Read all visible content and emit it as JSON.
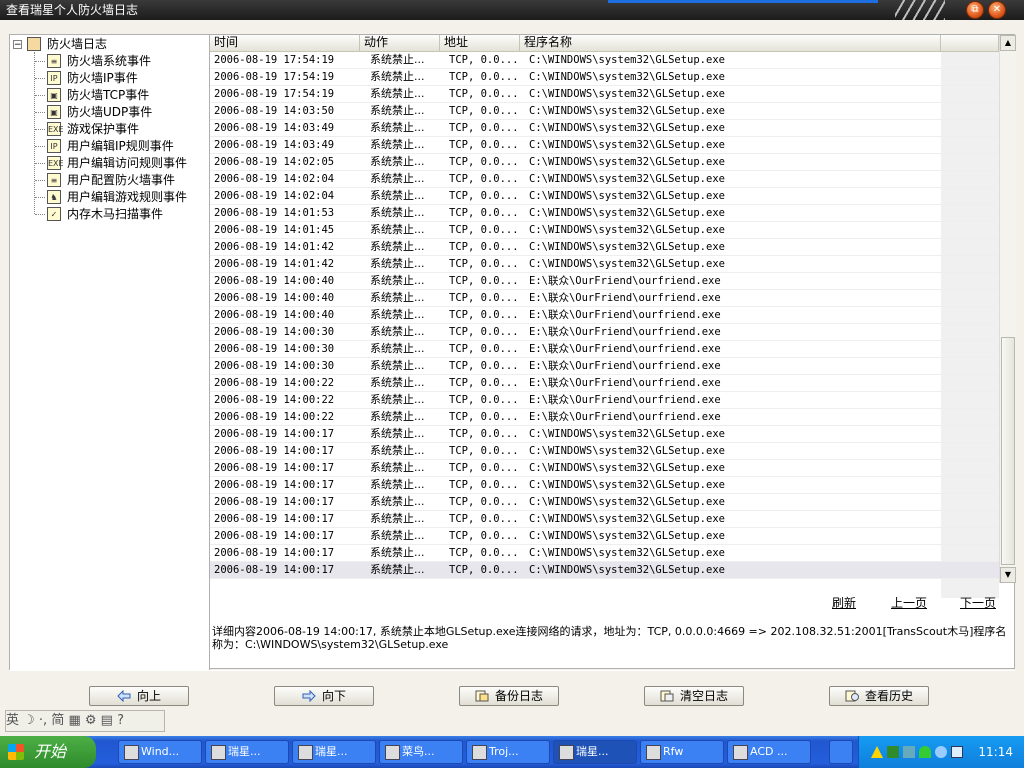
{
  "window": {
    "title": "查看瑞星个人防火墙日志",
    "restore_glyph": "⧉",
    "close_glyph": "✕"
  },
  "tree": {
    "root": {
      "label": "防火墙日志",
      "expander": "−"
    },
    "items": [
      {
        "label": "防火墙系统事件",
        "icon": "system-event-icon",
        "glyph": "≡"
      },
      {
        "label": "防火墙IP事件",
        "icon": "ip-event-icon",
        "glyph": "IP"
      },
      {
        "label": "防火墙TCP事件",
        "icon": "tcp-event-icon",
        "glyph": "▣"
      },
      {
        "label": "防火墙UDP事件",
        "icon": "udp-event-icon",
        "glyph": "▣"
      },
      {
        "label": "游戏保护事件",
        "icon": "game-protect-icon",
        "glyph": "EXE"
      },
      {
        "label": "用户编辑IP规则事件",
        "icon": "edit-ip-rule-icon",
        "glyph": "IP"
      },
      {
        "label": "用户编辑访问规则事件",
        "icon": "edit-access-rule-icon",
        "glyph": "EXE"
      },
      {
        "label": "用户配置防火墙事件",
        "icon": "config-firewall-icon",
        "glyph": "≡"
      },
      {
        "label": "用户编辑游戏规则事件",
        "icon": "edit-game-rule-icon",
        "glyph": "♞"
      },
      {
        "label": "内存木马扫描事件",
        "icon": "memory-trojan-scan-icon",
        "glyph": "✓"
      }
    ]
  },
  "table": {
    "columns": [
      "时间",
      "动作",
      "地址",
      "程序名称",
      ""
    ],
    "rows": [
      [
        "2006-08-19 17:54:19",
        "系统禁止...",
        "TCP, 0.0...",
        "C:\\WINDOWS\\system32\\GLSetup.exe"
      ],
      [
        "2006-08-19 17:54:19",
        "系统禁止...",
        "TCP, 0.0...",
        "C:\\WINDOWS\\system32\\GLSetup.exe"
      ],
      [
        "2006-08-19 17:54:19",
        "系统禁止...",
        "TCP, 0.0...",
        "C:\\WINDOWS\\system32\\GLSetup.exe"
      ],
      [
        "2006-08-19 14:03:50",
        "系统禁止...",
        "TCP, 0.0...",
        "C:\\WINDOWS\\system32\\GLSetup.exe"
      ],
      [
        "2006-08-19 14:03:49",
        "系统禁止...",
        "TCP, 0.0...",
        "C:\\WINDOWS\\system32\\GLSetup.exe"
      ],
      [
        "2006-08-19 14:03:49",
        "系统禁止...",
        "TCP, 0.0...",
        "C:\\WINDOWS\\system32\\GLSetup.exe"
      ],
      [
        "2006-08-19 14:02:05",
        "系统禁止...",
        "TCP, 0.0...",
        "C:\\WINDOWS\\system32\\GLSetup.exe"
      ],
      [
        "2006-08-19 14:02:04",
        "系统禁止...",
        "TCP, 0.0...",
        "C:\\WINDOWS\\system32\\GLSetup.exe"
      ],
      [
        "2006-08-19 14:02:04",
        "系统禁止...",
        "TCP, 0.0...",
        "C:\\WINDOWS\\system32\\GLSetup.exe"
      ],
      [
        "2006-08-19 14:01:53",
        "系统禁止...",
        "TCP, 0.0...",
        "C:\\WINDOWS\\system32\\GLSetup.exe"
      ],
      [
        "2006-08-19 14:01:45",
        "系统禁止...",
        "TCP, 0.0...",
        "C:\\WINDOWS\\system32\\GLSetup.exe"
      ],
      [
        "2006-08-19 14:01:42",
        "系统禁止...",
        "TCP, 0.0...",
        "C:\\WINDOWS\\system32\\GLSetup.exe"
      ],
      [
        "2006-08-19 14:01:42",
        "系统禁止...",
        "TCP, 0.0...",
        "C:\\WINDOWS\\system32\\GLSetup.exe"
      ],
      [
        "2006-08-19 14:00:40",
        "系统禁止...",
        "TCP, 0.0...",
        "E:\\联众\\OurFriend\\ourfriend.exe"
      ],
      [
        "2006-08-19 14:00:40",
        "系统禁止...",
        "TCP, 0.0...",
        "E:\\联众\\OurFriend\\ourfriend.exe"
      ],
      [
        "2006-08-19 14:00:40",
        "系统禁止...",
        "TCP, 0.0...",
        "E:\\联众\\OurFriend\\ourfriend.exe"
      ],
      [
        "2006-08-19 14:00:30",
        "系统禁止...",
        "TCP, 0.0...",
        "E:\\联众\\OurFriend\\ourfriend.exe"
      ],
      [
        "2006-08-19 14:00:30",
        "系统禁止...",
        "TCP, 0.0...",
        "E:\\联众\\OurFriend\\ourfriend.exe"
      ],
      [
        "2006-08-19 14:00:30",
        "系统禁止...",
        "TCP, 0.0...",
        "E:\\联众\\OurFriend\\ourfriend.exe"
      ],
      [
        "2006-08-19 14:00:22",
        "系统禁止...",
        "TCP, 0.0...",
        "E:\\联众\\OurFriend\\ourfriend.exe"
      ],
      [
        "2006-08-19 14:00:22",
        "系统禁止...",
        "TCP, 0.0...",
        "E:\\联众\\OurFriend\\ourfriend.exe"
      ],
      [
        "2006-08-19 14:00:22",
        "系统禁止...",
        "TCP, 0.0...",
        "E:\\联众\\OurFriend\\ourfriend.exe"
      ],
      [
        "2006-08-19 14:00:17",
        "系统禁止...",
        "TCP, 0.0...",
        "C:\\WINDOWS\\system32\\GLSetup.exe"
      ],
      [
        "2006-08-19 14:00:17",
        "系统禁止...",
        "TCP, 0.0...",
        "C:\\WINDOWS\\system32\\GLSetup.exe"
      ],
      [
        "2006-08-19 14:00:17",
        "系统禁止...",
        "TCP, 0.0...",
        "C:\\WINDOWS\\system32\\GLSetup.exe"
      ],
      [
        "2006-08-19 14:00:17",
        "系统禁止...",
        "TCP, 0.0...",
        "C:\\WINDOWS\\system32\\GLSetup.exe"
      ],
      [
        "2006-08-19 14:00:17",
        "系统禁止...",
        "TCP, 0.0...",
        "C:\\WINDOWS\\system32\\GLSetup.exe"
      ],
      [
        "2006-08-19 14:00:17",
        "系统禁止...",
        "TCP, 0.0...",
        "C:\\WINDOWS\\system32\\GLSetup.exe"
      ],
      [
        "2006-08-19 14:00:17",
        "系统禁止...",
        "TCP, 0.0...",
        "C:\\WINDOWS\\system32\\GLSetup.exe"
      ],
      [
        "2006-08-19 14:00:17",
        "系统禁止...",
        "TCP, 0.0...",
        "C:\\WINDOWS\\system32\\GLSetup.exe"
      ],
      [
        "2006-08-19 14:00:17",
        "系统禁止...",
        "TCP, 0.0...",
        "C:\\WINDOWS\\system32\\GLSetup.exe"
      ]
    ],
    "selected_row": 30
  },
  "scrollbar": {
    "up_glyph": "▲",
    "down_glyph": "▼"
  },
  "pager": {
    "refresh": "刷新",
    "prev": "上一页",
    "next": "下一页"
  },
  "detail_text": "详细内容2006-08-19 14:00:17, 系统禁止本地GLSetup.exe连接网络的请求，地址为：TCP, 0.0.0.0:4669 => 202.108.32.51:2001[TransScout木马]程序名称为：C:\\WINDOWS\\system32\\GLSetup.exe",
  "buttons": {
    "up": "向上",
    "down": "向下",
    "backup": "备份日志",
    "clear": "清空日志",
    "history": "查看历史"
  },
  "ime_bar": {
    "text": "英 ☽ ·, 简 ▦ ⚙ ▤ ?"
  },
  "taskbar": {
    "start_label": "开始",
    "tasks": [
      {
        "label": "Wind...",
        "active": false
      },
      {
        "label": "瑞星...",
        "active": false
      },
      {
        "label": "瑞星...",
        "active": false
      },
      {
        "label": "菜鸟...",
        "active": false
      },
      {
        "label": "Troj...",
        "active": false
      },
      {
        "label": "瑞星...",
        "active": true
      },
      {
        "label": "Rfw",
        "active": false
      },
      {
        "label": "ACD ...",
        "active": false
      }
    ],
    "clock": "11:14"
  },
  "colors": {
    "title_bar": "#2a2a2a",
    "taskbar": "#245edb",
    "start_button": "#3c9c36",
    "tray": "#0f8be6",
    "selected_row": "#e6e6ec"
  }
}
